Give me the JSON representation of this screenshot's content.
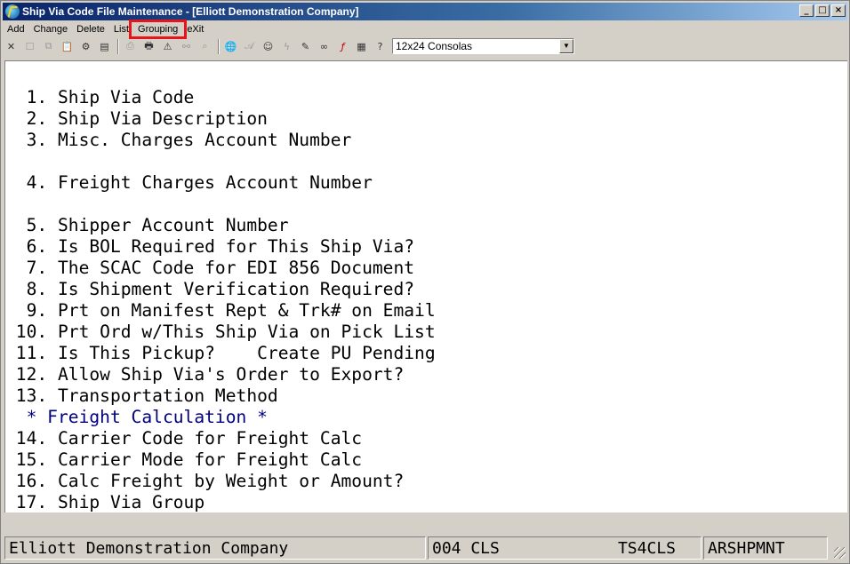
{
  "window": {
    "title": "Ship Via Code File Maintenance - [Elliott Demonstration Company]",
    "controls": {
      "minimize": "_",
      "maximize": "□",
      "close": "×"
    }
  },
  "menu": [
    {
      "label": "Add"
    },
    {
      "label": "Change"
    },
    {
      "label": "Delete"
    },
    {
      "label": "List"
    },
    {
      "label": "Grouping",
      "highlighted": true
    },
    {
      "label": "eXit"
    }
  ],
  "toolbar": {
    "font_select": {
      "value": "12x24 Consolas"
    },
    "icons": [
      "close-icon",
      "blank-icon",
      "copy-icon",
      "paste-icon",
      "settings-icon",
      "properties-icon",
      "print-icon",
      "print-setup-icon",
      "alert-icon",
      "binoculars-icon",
      "magnifier-icon",
      "globe-icon",
      "font-icon",
      "user-icon",
      "lightning-icon",
      "script-icon",
      "link-icon",
      "function-icon",
      "notes-icon",
      "help-icon"
    ]
  },
  "terminal": {
    "lines": [
      {
        "text": "  1. Ship Via Code",
        "color": "#000000"
      },
      {
        "text": "  2. Ship Via Description",
        "color": "#000000"
      },
      {
        "text": "  3. Misc. Charges Account Number",
        "color": "#000000"
      },
      {
        "text": "",
        "color": "#000000"
      },
      {
        "text": "  4. Freight Charges Account Number",
        "color": "#000000"
      },
      {
        "text": "",
        "color": "#000000"
      },
      {
        "text": "  5. Shipper Account Number",
        "color": "#000000"
      },
      {
        "text": "  6. Is BOL Required for This Ship Via?",
        "color": "#000000"
      },
      {
        "text": "  7. The SCAC Code for EDI 856 Document",
        "color": "#000000"
      },
      {
        "text": "  8. Is Shipment Verification Required?",
        "color": "#000000"
      },
      {
        "text": "  9. Prt on Manifest Rept & Trk# on Email",
        "color": "#000000"
      },
      {
        "text": " 10. Prt Ord w/This Ship Via on Pick List",
        "color": "#000000"
      },
      {
        "text": " 11. Is This Pickup?    Create PU Pending",
        "color": "#000000"
      },
      {
        "text": " 12. Allow Ship Via's Order to Export?",
        "color": "#000000"
      },
      {
        "text": " 13. Transportation Method",
        "color": "#000000"
      },
      {
        "text": "  * Freight Calculation *",
        "color": "#000080"
      },
      {
        "text": " 14. Carrier Code for Freight Calc",
        "color": "#000000"
      },
      {
        "text": " 15. Carrier Mode for Freight Calc",
        "color": "#000000"
      },
      {
        "text": " 16. Calc Freight by Weight or Amount?",
        "color": "#000000"
      },
      {
        "text": " 17. Ship Via Group",
        "color": "#000000"
      }
    ]
  },
  "statusbar": {
    "company": "Elliott Demonstration Company",
    "session": "004 CLS",
    "station": "TS4CLS",
    "program": "ARSHPMNT"
  }
}
